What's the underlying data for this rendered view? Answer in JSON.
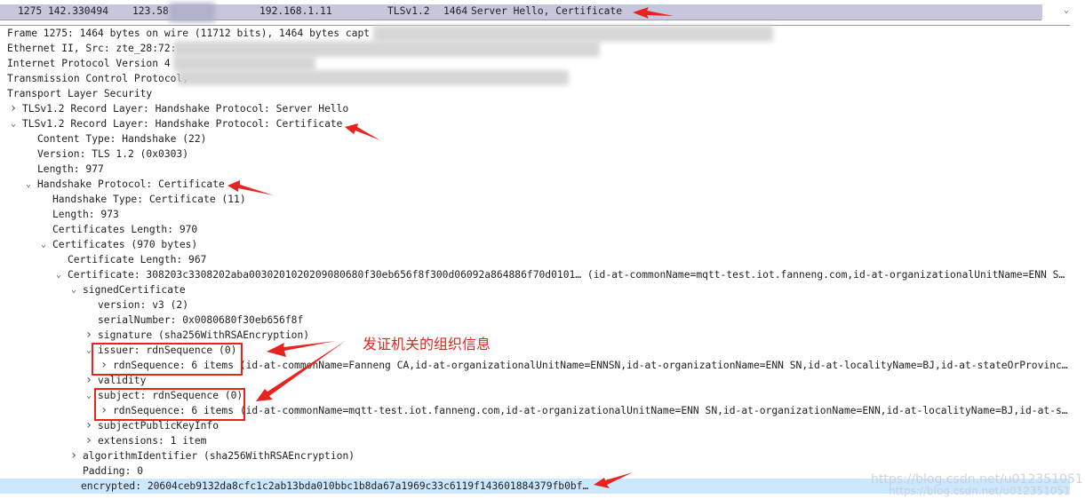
{
  "packet_row": {
    "no": "1275",
    "time": "142.330494",
    "source": "123.58",
    "destination": "192.168.1.11",
    "protocol": "TLSv1.2",
    "length": "1464",
    "info": "Server Hello, Certificate"
  },
  "tree": [
    {
      "text": "Frame 1275: 1464 bytes on wire (11712 bits), 1464 bytes capt",
      "level": 0,
      "twisty": "none"
    },
    {
      "text": "Ethernet II, Src: zte_28:72:",
      "level": 0,
      "twisty": "none"
    },
    {
      "text": "Internet Protocol Version 4",
      "level": 0,
      "twisty": "none"
    },
    {
      "text": "Transmission Control Protocol,",
      "level": 0,
      "twisty": "none"
    },
    {
      "text": "Transport Layer Security",
      "level": 0,
      "twisty": "none"
    },
    {
      "text": "TLSv1.2 Record Layer: Handshake Protocol: Server Hello",
      "level": 1,
      "twisty": "collapsed"
    },
    {
      "text": "TLSv1.2 Record Layer: Handshake Protocol: Certificate",
      "level": 1,
      "twisty": "expanded"
    },
    {
      "text": "Content Type: Handshake (22)",
      "level": 2,
      "twisty": "none"
    },
    {
      "text": "Version: TLS 1.2 (0x0303)",
      "level": 2,
      "twisty": "none"
    },
    {
      "text": "Length: 977",
      "level": 2,
      "twisty": "none"
    },
    {
      "text": "Handshake Protocol: Certificate",
      "level": 2,
      "twisty": "expanded"
    },
    {
      "text": "Handshake Type: Certificate (11)",
      "level": 3,
      "twisty": "none"
    },
    {
      "text": "Length: 973",
      "level": 3,
      "twisty": "none"
    },
    {
      "text": "Certificates Length: 970",
      "level": 3,
      "twisty": "none"
    },
    {
      "text": "Certificates (970 bytes)",
      "level": 3,
      "twisty": "expanded"
    },
    {
      "text": "Certificate Length: 967",
      "level": 4,
      "twisty": "none"
    },
    {
      "text": "Certificate: 308203c3308202aba0030201020209080680f30eb656f8f300d06092a864886f70d0101… (id-at-commonName=mqtt-test.iot.fanneng.com,id-at-organizationalUnitName=ENN S…",
      "level": 4,
      "twisty": "expanded"
    },
    {
      "text": "signedCertificate",
      "level": 5,
      "twisty": "expanded"
    },
    {
      "text": "version: v3 (2)",
      "level": 6,
      "twisty": "none"
    },
    {
      "text": "serialNumber: 0x0080680f30eb656f8f",
      "level": 6,
      "twisty": "none"
    },
    {
      "text": "signature (sha256WithRSAEncryption)",
      "level": 6,
      "twisty": "collapsed"
    },
    {
      "text": "issuer: rdnSequence (0)",
      "level": 6,
      "twisty": "expanded"
    },
    {
      "text": "rdnSequence: 6 items (id-at-commonName=Fanneng CA,id-at-organizationalUnitName=ENNSN,id-at-organizationName=ENN SN,id-at-localityName=BJ,id-at-stateOrProvinc…",
      "level": 7,
      "twisty": "collapsed"
    },
    {
      "text": "validity",
      "level": 6,
      "twisty": "collapsed"
    },
    {
      "text": "subject: rdnSequence (0)",
      "level": 6,
      "twisty": "expanded"
    },
    {
      "text": "rdnSequence: 6 items (id-at-commonName=mqtt-test.iot.fanneng.com,id-at-organizationalUnitName=ENN SN,id-at-organizationName=ENN,id-at-localityName=BJ,id-at-s…",
      "level": 7,
      "twisty": "collapsed"
    },
    {
      "text": "subjectPublicKeyInfo",
      "level": 6,
      "twisty": "collapsed"
    },
    {
      "text": "extensions: 1 item",
      "level": 6,
      "twisty": "collapsed"
    },
    {
      "text": "algorithmIdentifier (sha256WithRSAEncryption)",
      "level": 5,
      "twisty": "collapsed"
    },
    {
      "text": "Padding: 0",
      "level": 5,
      "twisty": "none"
    },
    {
      "text": "encrypted: 20604ceb9132da8cfc1c2ab13bda010bbc1b8da67a1969c33c6119f143601884379fb0bf…",
      "level": 5,
      "twisty": "none",
      "selected": true
    }
  ],
  "annotation": "发证机关的组织信息",
  "watermark": "https://blog.csdn.net/u012351051",
  "colors": {
    "annotation": "#e8231f",
    "selected_row": "#cce8ff",
    "packet_row": "#c6c6dc"
  }
}
